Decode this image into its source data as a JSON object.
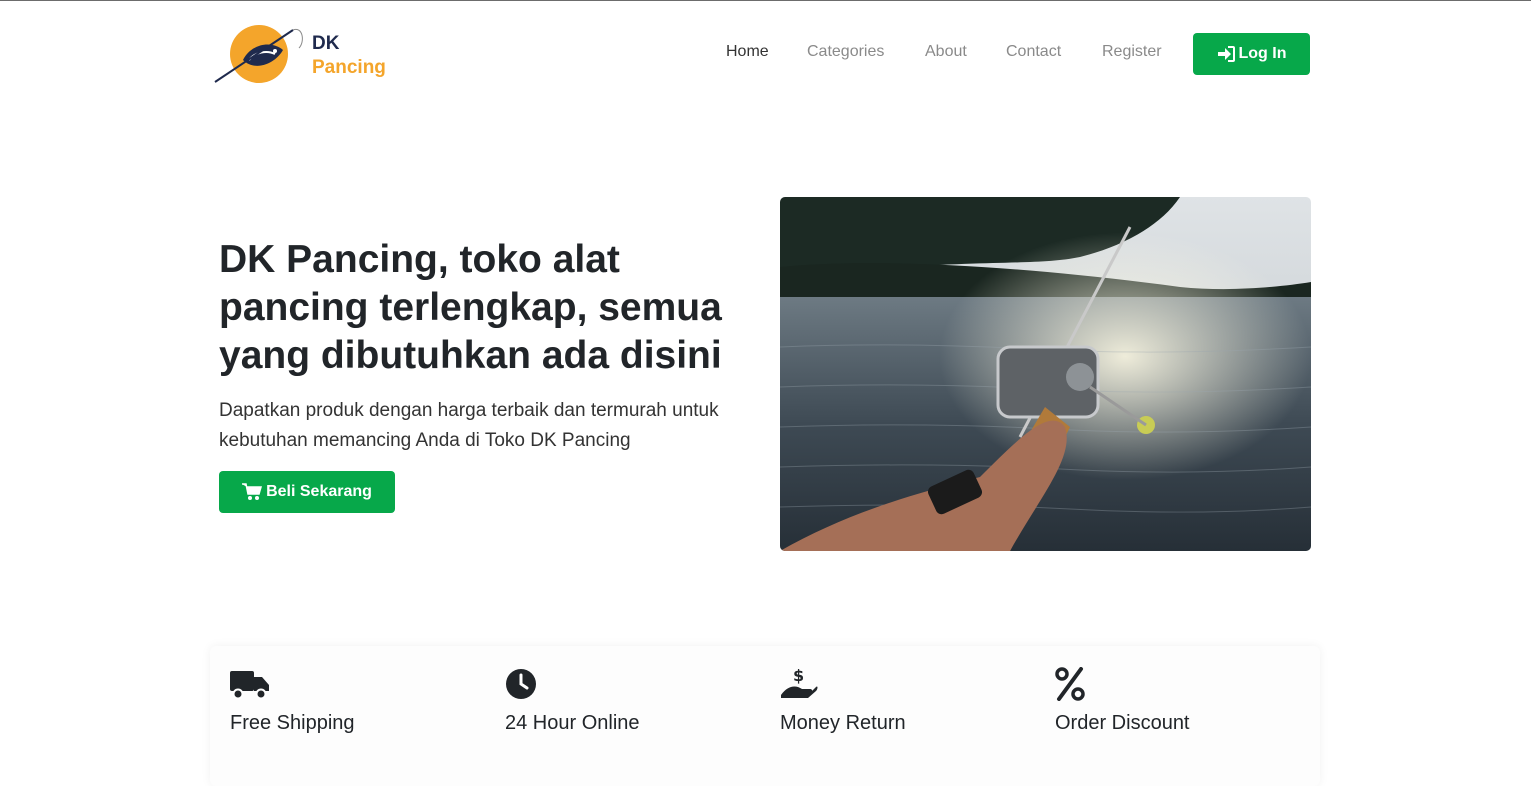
{
  "brand": {
    "line1": "DK",
    "line2": "Pancing",
    "logo_icon": "fishing-rod-fish-logo"
  },
  "nav": {
    "items": [
      {
        "label": "Home",
        "active": true
      },
      {
        "label": "Categories",
        "active": false
      },
      {
        "label": "About",
        "active": false
      },
      {
        "label": "Contact",
        "active": false
      },
      {
        "label": "Register",
        "active": false
      }
    ],
    "login_label": "Log In",
    "login_icon": "sign-in-icon"
  },
  "hero": {
    "title": "DK Pancing, toko alat pancing terlengkap, semua yang dibutuhkan ada disini",
    "subtitle": "Dapatkan produk dengan harga terbaik dan termurah untuk kebutuhan memancing Anda di Toko DK Pancing",
    "cta_label": "Beli Sekarang",
    "cta_icon": "cart-icon"
  },
  "features": [
    {
      "icon": "truck-icon",
      "title": "Free Shipping"
    },
    {
      "icon": "clock-icon",
      "title": "24 Hour Online"
    },
    {
      "icon": "money-hand-icon",
      "title": "Money Return"
    },
    {
      "icon": "percent-icon",
      "title": "Order Discount"
    }
  ],
  "colors": {
    "accent": "#07a84a",
    "brand_dark": "#1f2a4d",
    "brand_orange": "#f4a52b"
  }
}
